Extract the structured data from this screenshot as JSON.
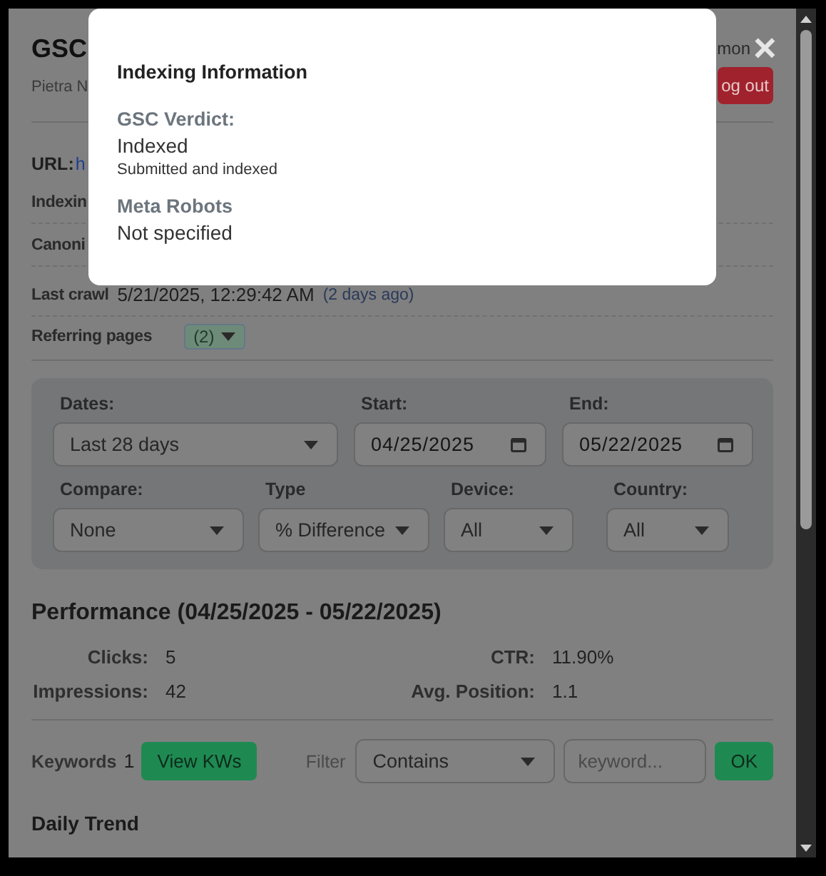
{
  "header": {
    "title": "GSC",
    "subtitle": "Pietra N",
    "link": "mon",
    "logout_button": "og out"
  },
  "url": {
    "label": "URL:",
    "value": "h"
  },
  "details": [
    {
      "label": "Indexin"
    },
    {
      "label": "Canoni"
    },
    {
      "label": "Last crawl",
      "value": "5/21/2025, 12:29:42 AM",
      "note": "(2 days ago)"
    }
  ],
  "referring": {
    "label": "Referring pages",
    "badge": "(2)"
  },
  "filters": {
    "date_range": [
      {
        "kind": "select",
        "label": "Dates:",
        "value": "Last 28 days"
      },
      {
        "kind": "date",
        "label": "Start:",
        "value": "04/25/2025"
      },
      {
        "kind": "date",
        "label": "End:",
        "value": "05/22/2025"
      }
    ],
    "options": [
      {
        "kind": "select",
        "label": "Compare:",
        "value": "None"
      },
      {
        "kind": "select",
        "label": "Type",
        "value": "% Difference"
      },
      {
        "kind": "select",
        "label": "Device:",
        "value": "All"
      },
      {
        "kind": "select",
        "label": "Country:",
        "value": "All"
      }
    ]
  },
  "performance": {
    "title": "Performance (04/25/2025 - 05/22/2025)",
    "metrics": [
      {
        "label": "Clicks:",
        "value": "5"
      },
      {
        "label": "CTR:",
        "value": "11.90%"
      },
      {
        "label": "Impressions:",
        "value": "42"
      },
      {
        "label": "Avg. Position:",
        "value": "1.1"
      }
    ]
  },
  "keywords": {
    "label": "Keywords",
    "count": "1",
    "view_button": "View KWs",
    "filter_label": "Filter",
    "filter_select": "Contains",
    "keyword_placeholder": "keyword...",
    "ok_button": "OK"
  },
  "daily_trend": {
    "title": "Daily Trend"
  },
  "modal": {
    "title": "Indexing Information",
    "close": "×",
    "sections": [
      {
        "heading": "GSC Verdict:",
        "value": "Indexed",
        "detail": "Submitted and indexed"
      },
      {
        "heading": "Meta Robots",
        "value": "Not specified"
      }
    ]
  }
}
